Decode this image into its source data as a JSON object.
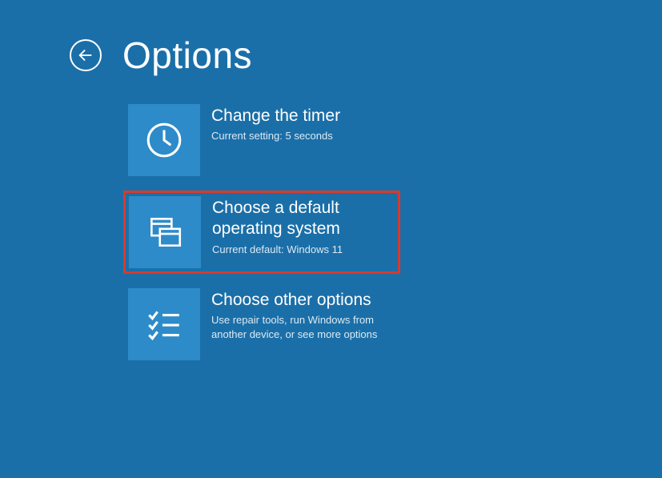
{
  "page": {
    "title": "Options"
  },
  "options": [
    {
      "title": "Change the timer",
      "subtitle": "Current setting: 5 seconds"
    },
    {
      "title": "Choose a default operating system",
      "subtitle": "Current default: Windows 11"
    },
    {
      "title": "Choose other options",
      "subtitle": "Use repair tools, run Windows from another device, or see more options"
    }
  ],
  "highlightedIndex": 1,
  "colors": {
    "background": "#1b6fa8",
    "tile": "#2e8bc9",
    "highlight": "#d93a2b"
  }
}
